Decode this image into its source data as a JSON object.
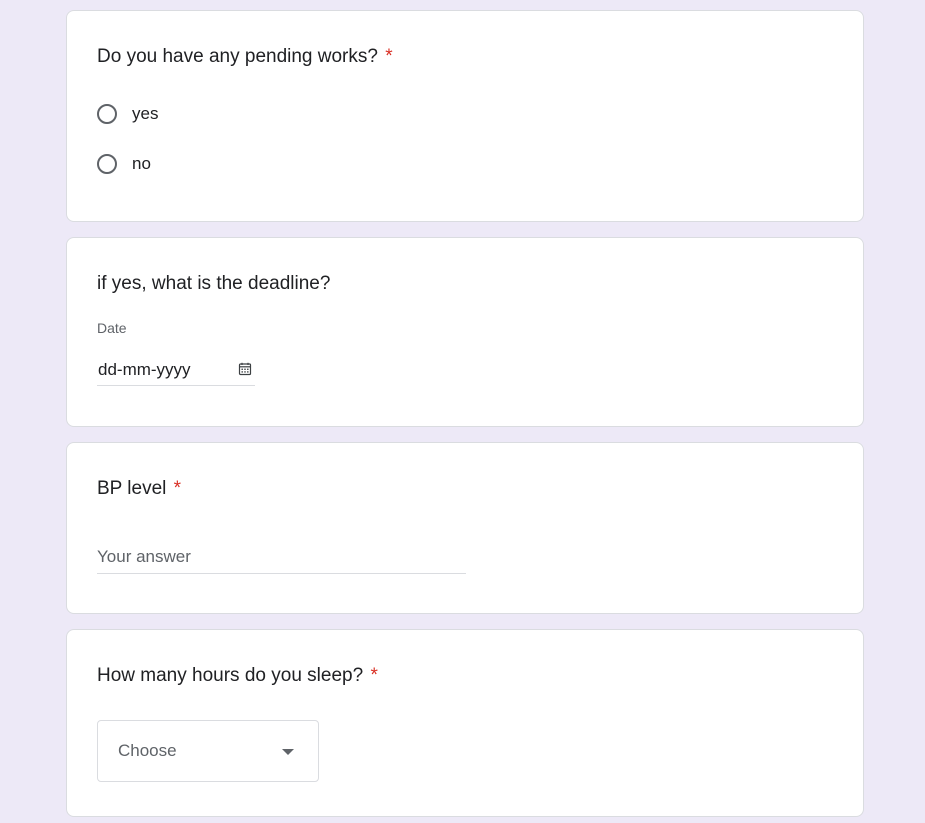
{
  "questions": {
    "pending_works": {
      "title": "Do you have any pending works?",
      "required_mark": "*",
      "options": [
        {
          "label": "yes",
          "selected": false
        },
        {
          "label": "no",
          "selected": false
        }
      ]
    },
    "deadline": {
      "title": "if yes, what is the deadline?",
      "field_caption": "Date",
      "placeholder": "dd-mm-yyyy",
      "icon": "calendar-icon"
    },
    "bp_level": {
      "title": "BP level",
      "required_mark": "*",
      "placeholder": "Your answer"
    },
    "sleep_hours": {
      "title": "How many hours do you sleep?",
      "required_mark": "*",
      "selected_value": "Choose",
      "icon": "dropdown-arrow-icon"
    }
  },
  "colors": {
    "page_background": "#ede9f7",
    "card_background": "#ffffff",
    "required_asterisk": "#d93025",
    "border": "#dadce0"
  }
}
